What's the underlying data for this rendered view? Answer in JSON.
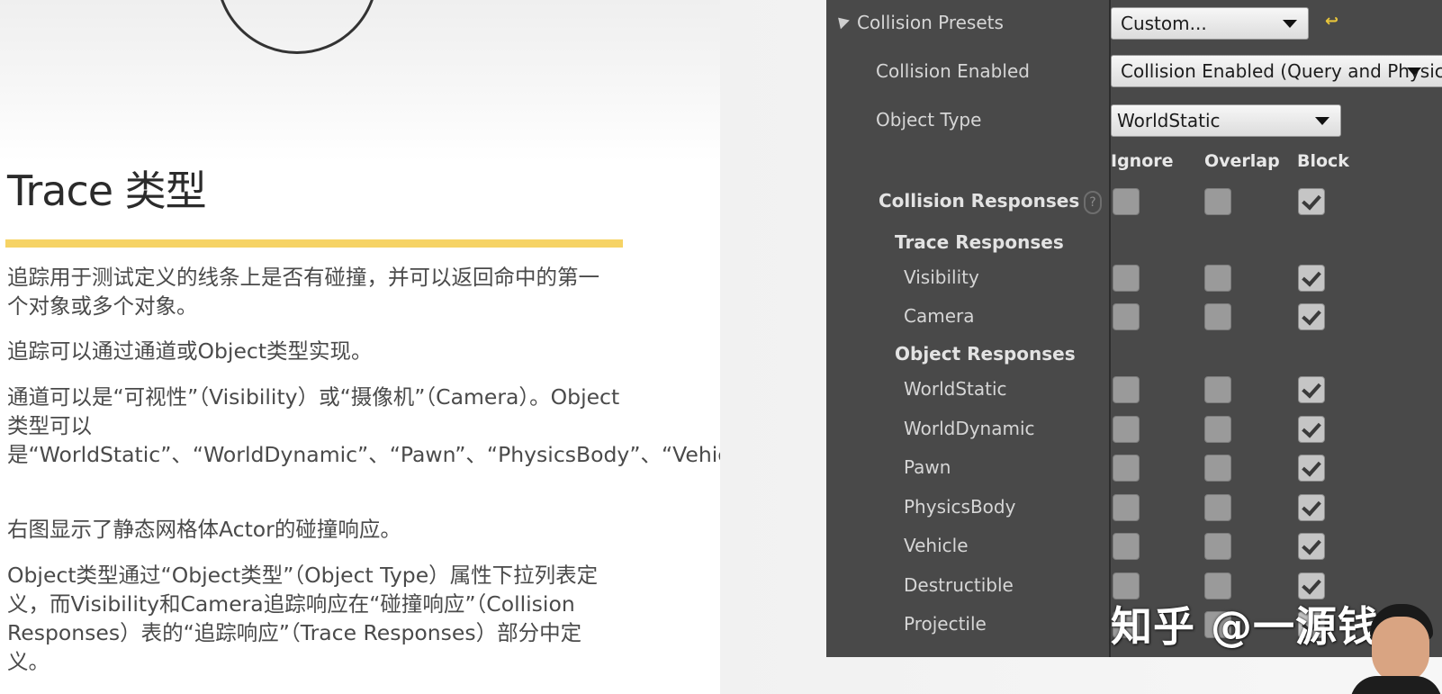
{
  "slide": {
    "title": "Trace 类型",
    "paragraphs": [
      "追踪用于测试定义的线条上是否有碰撞，并可以返回命中的第一个对象或多个对象。",
      "追踪可以通过通道或Object类型实现。",
      "通道可以是“可视性”（Visibility）或“摄像机”（Camera）。Object类型可以是“WorldStatic”、“WorldDynamic”、“Pawn”、“PhysicsBody”、“Vehicle”、“Destructible”或“Projectile”。",
      "右图显示了静态网格体Actor的碰撞响应。",
      "Object类型通过“Object类型”（Object Type）属性下拉列表定义，而Visibility和Camera追踪响应在“碰撞响应”（Collision Responses）表的“追踪响应”（Trace Responses）部分中定义。"
    ]
  },
  "panel": {
    "collision_presets_label": "Collision Presets",
    "collision_presets_value": "Custom...",
    "collision_enabled_label": "Collision Enabled",
    "collision_enabled_value": "Collision Enabled (Query and Physics)",
    "object_type_label": "Object Type",
    "object_type_value": "WorldStatic",
    "columns": [
      "Ignore",
      "Overlap",
      "Block"
    ],
    "collision_responses_label": "Collision Responses",
    "trace_responses_label": "Trace Responses",
    "object_responses_label": "Object Responses",
    "trace_rows": [
      {
        "label": "Visibility",
        "ignore": false,
        "overlap": false,
        "block": true
      },
      {
        "label": "Camera",
        "ignore": false,
        "overlap": false,
        "block": true
      }
    ],
    "object_rows": [
      {
        "label": "WorldStatic",
        "ignore": false,
        "overlap": false,
        "block": true
      },
      {
        "label": "WorldDynamic",
        "ignore": false,
        "overlap": false,
        "block": true
      },
      {
        "label": "Pawn",
        "ignore": false,
        "overlap": false,
        "block": true
      },
      {
        "label": "PhysicsBody",
        "ignore": false,
        "overlap": false,
        "block": true
      },
      {
        "label": "Vehicle",
        "ignore": false,
        "overlap": false,
        "block": true
      },
      {
        "label": "Destructible",
        "ignore": false,
        "overlap": false,
        "block": true
      },
      {
        "label": "Projectile",
        "ignore": false,
        "overlap": false,
        "block": true
      }
    ],
    "collision_responses_all": {
      "ignore": false,
      "overlap": false,
      "block": true
    }
  },
  "watermark": "知乎 @一源钱",
  "icons": {
    "logo": "ue-logo-icon",
    "reset": "reset-arrow-icon",
    "help": "help-icon",
    "expand": "expand-triangle-icon"
  },
  "colors": {
    "accent_rule": "#f6d365",
    "panel_bg": "#494949"
  }
}
